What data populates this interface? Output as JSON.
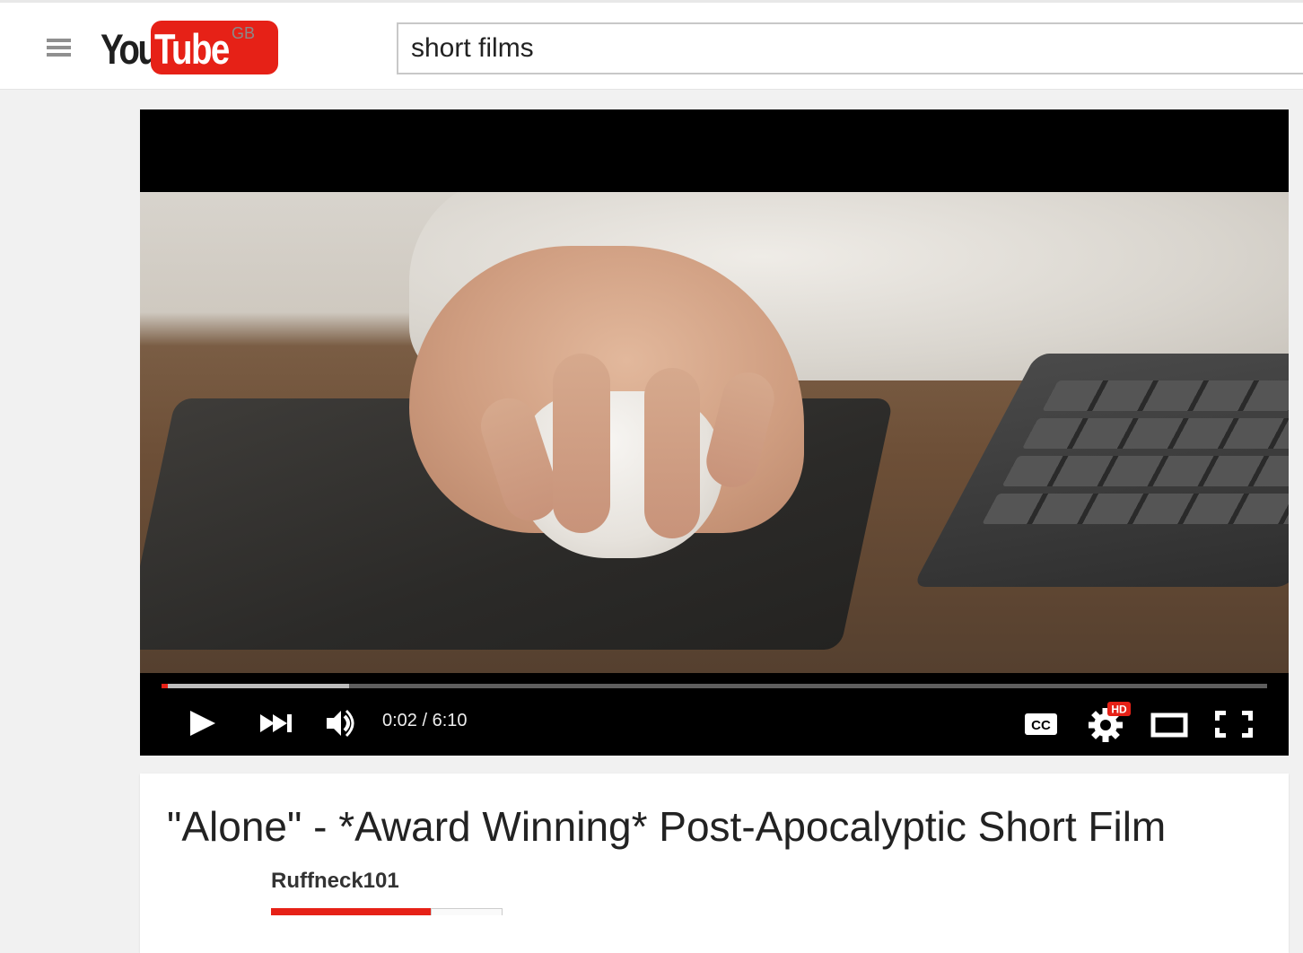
{
  "header": {
    "logo_you": "You",
    "logo_tube": "Tube",
    "country": "GB",
    "search_value": "short films"
  },
  "player": {
    "current_time": "0:02",
    "duration": "6:10",
    "time_display": "0:02 / 6:10",
    "progress_fraction": 0.0054,
    "buffered_fraction": 0.17,
    "hd_badge": "HD",
    "cc_label": "CC",
    "icons": [
      "play-icon",
      "next-icon",
      "volume-icon",
      "captions-icon",
      "settings-icon",
      "theater-mode-icon",
      "fullscreen-icon"
    ],
    "accent_color": "#e62117"
  },
  "video": {
    "title": "\"Alone\" - *Award Winning* Post-Apocalyptic Short Film",
    "channel": "Ruffneck101"
  }
}
